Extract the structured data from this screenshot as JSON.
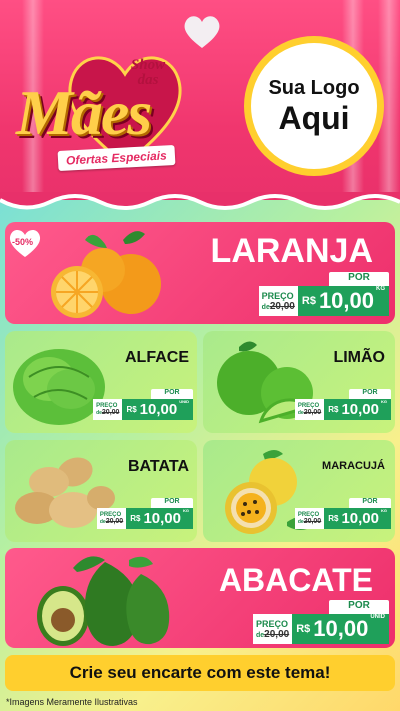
{
  "header": {
    "brand_show": "Show",
    "brand_das": "das",
    "brand_title": "Mães",
    "brand_subtitle": "Ofertas Especiais",
    "logo_line1": "Sua Logo",
    "logo_line2": "Aqui"
  },
  "discount_badge": "-50%",
  "price_labels": {
    "por": "POR",
    "preco": "PREÇO",
    "de": "de",
    "currency": "R$"
  },
  "products": [
    {
      "name": "LARANJA",
      "old_price": "20,00",
      "new_price": "10,00",
      "unit": "KG"
    },
    {
      "name": "ALFACE",
      "old_price": "20,00",
      "new_price": "10,00",
      "unit": "UNID"
    },
    {
      "name": "LIMÃO",
      "old_price": "20,00",
      "new_price": "10,00",
      "unit": "KG"
    },
    {
      "name": "BATATA",
      "old_price": "20,00",
      "new_price": "10,00",
      "unit": "KG"
    },
    {
      "name": "MARACUJÁ",
      "old_price": "20,00",
      "new_price": "10,00",
      "unit": "KG"
    },
    {
      "name": "ABACATE",
      "old_price": "20,00",
      "new_price": "10,00",
      "unit": "UNID"
    }
  ],
  "cta": "Crie seu encarte com este tema!",
  "footnote": "*Imagens Meramente Ilustrativas",
  "colors": {
    "pink": "#ed2f6b",
    "green_price": "#1fa05a",
    "yellow": "#ffcf2e"
  }
}
